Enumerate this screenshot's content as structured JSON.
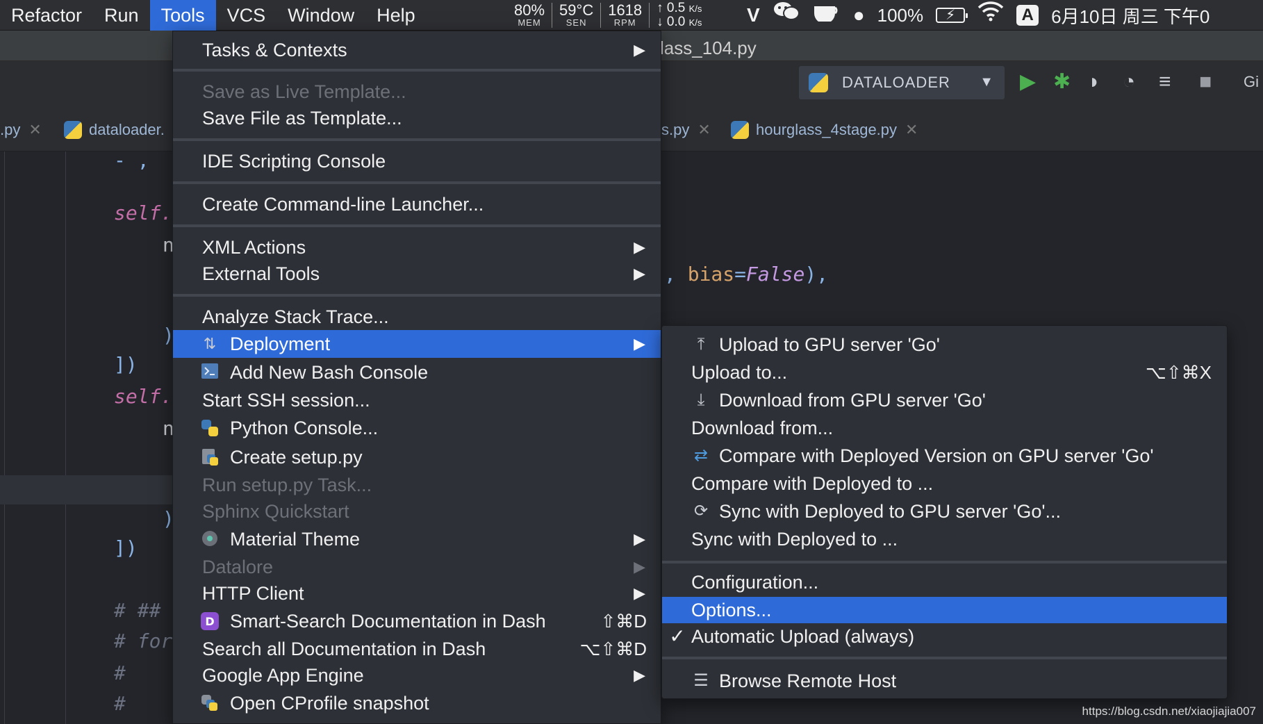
{
  "menubar": {
    "items": [
      "Refactor",
      "Run",
      "Tools",
      "VCS",
      "Window",
      "Help"
    ],
    "active": "Tools",
    "stats": [
      {
        "value": "80%",
        "unit": "MEM"
      },
      {
        "value": "59°C",
        "unit": "SEN"
      },
      {
        "value": "1618",
        "unit": "RPM"
      }
    ],
    "net_up": "↑ 0.5",
    "net_down": "↓ 0.0",
    "net_unit": "K/s",
    "battery": "100%",
    "input_method": "A",
    "clock": "6月10日 周三 下午0"
  },
  "ide": {
    "title_fragment": "lass_104.py",
    "run_config": "DATALOADER",
    "toolbar_git": "Gi",
    "tabs": [
      ".py",
      "dataloader.",
      "s.py",
      "hourglass_4stage.py"
    ],
    "code": {
      "line1": "- ,",
      "self1": "self.",
      "n1": "n",
      "paren1": ")",
      "bracket1": "])",
      "self2": "self.",
      "n2": "n",
      "paren2": ")",
      "bracket2": "])",
      "c1": "# ##",
      "c2": "# for",
      "c3": "#",
      "c4": "#",
      "bias_comma": ",",
      "bias_kw": "bias",
      "bias_eq": "=",
      "bias_val": "False",
      "bias_end": "),"
    }
  },
  "tools_menu": {
    "items": [
      {
        "label": "Tasks & Contexts",
        "submenu": true
      },
      {
        "label": "Save as Live Template...",
        "disabled": true
      },
      {
        "label": "Save File as Template..."
      },
      {
        "label": "IDE Scripting Console"
      },
      {
        "label": "Create Command-line Launcher..."
      },
      {
        "label": "XML Actions",
        "submenu": true
      },
      {
        "label": "External Tools",
        "submenu": true
      },
      {
        "label": "Analyze Stack Trace..."
      },
      {
        "label": "Deployment",
        "submenu": true,
        "selected": true,
        "icon": "deployment-icon"
      },
      {
        "label": "Add New Bash Console",
        "icon": "bash-console-icon"
      },
      {
        "label": "Start SSH session..."
      },
      {
        "label": "Python Console...",
        "icon": "python-console-icon"
      },
      {
        "label": "Create setup.py",
        "icon": "setup-py-icon"
      },
      {
        "label": "Run setup.py Task...",
        "disabled": true
      },
      {
        "label": "Sphinx Quickstart",
        "disabled": true
      },
      {
        "label": "Material Theme",
        "submenu": true,
        "icon": "material-theme-icon"
      },
      {
        "label": "Datalore",
        "submenu": true,
        "disabled": true
      },
      {
        "label": "HTTP Client",
        "submenu": true
      },
      {
        "label": "Smart-Search Documentation in Dash",
        "shortcut": "⇧⌘D",
        "icon": "dash-icon"
      },
      {
        "label": "Search all Documentation in Dash",
        "shortcut": "⌥⇧⌘D"
      },
      {
        "label": "Google App Engine",
        "submenu": true
      },
      {
        "label": "Open CProfile snapshot",
        "icon": "cprofile-icon"
      }
    ],
    "arrow": "▶"
  },
  "deployment_menu": {
    "items": [
      {
        "label": "Upload to GPU server 'Go'",
        "icon": "upload-icon"
      },
      {
        "label": "Upload to...",
        "shortcut": "⌥⇧⌘X"
      },
      {
        "label": "Download from GPU server 'Go'",
        "icon": "download-icon"
      },
      {
        "label": "Download from..."
      },
      {
        "label": "Compare with Deployed Version on GPU server 'Go'",
        "icon": "compare-icon"
      },
      {
        "label": "Compare with Deployed to ..."
      },
      {
        "label": "Sync with Deployed to GPU server 'Go'...",
        "icon": "sync-icon"
      },
      {
        "label": "Sync with Deployed to ..."
      },
      {
        "label": "Configuration..."
      },
      {
        "label": "Options...",
        "selected": true
      },
      {
        "label": "Automatic Upload (always)",
        "checked": true
      },
      {
        "label": "Browse Remote Host",
        "icon": "browse-remote-icon"
      }
    ],
    "check": "✓"
  },
  "watermark": "https://blog.csdn.net/xiaojiajia007",
  "colors": {
    "accent": "#2f6bd8",
    "menu_bg": "#2d3036",
    "disabled": "#6d7078"
  }
}
